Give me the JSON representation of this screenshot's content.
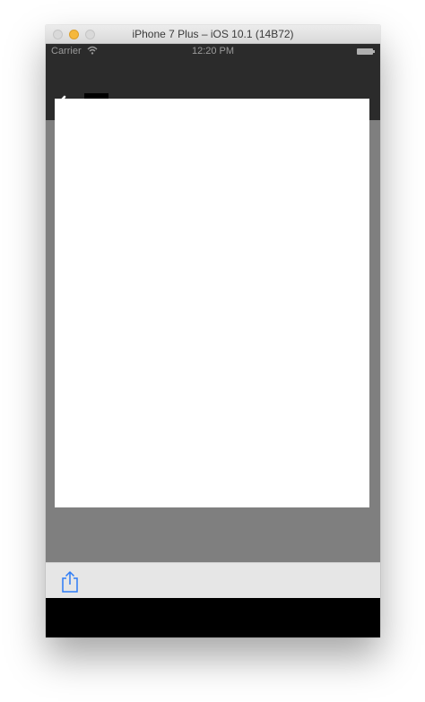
{
  "window": {
    "title": "iPhone 7 Plus – iOS 10.1 (14B72)"
  },
  "status_bar": {
    "carrier": "Carrier",
    "time": "12:20 PM",
    "icons": [
      "wifi-icon",
      "battery-icon"
    ]
  },
  "nav_bar": {
    "icons": [
      "chevron-left-icon"
    ]
  },
  "toolbar": {
    "icons": [
      "share-icon"
    ]
  },
  "colors": {
    "nav_background": "#2b2b2b",
    "content_background": "#7f7f7f",
    "sheet_background": "#ffffff",
    "toolbar_background": "#e6e6e6",
    "accent": "#2d7cf6"
  }
}
